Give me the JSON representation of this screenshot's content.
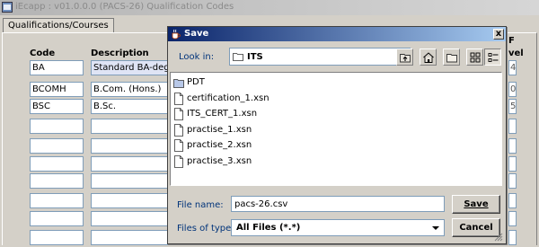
{
  "app": {
    "title": "iEcapp : v01.0.0.0 (PACS-26) Qualification Codes",
    "tab": "Qualifications/Courses"
  },
  "grid": {
    "headers": {
      "code": "Code",
      "description": "Description",
      "right_top": "F",
      "right_bottom": "vel"
    },
    "rows": [
      {
        "code": "BA",
        "description": "Standard BA-degree",
        "right": "4"
      },
      {
        "code": "BCOMH",
        "description": "B.Com. (Hons.)",
        "right": "0"
      },
      {
        "code": "BSC",
        "description": "B.Sc.",
        "right": "5"
      },
      {
        "code": "",
        "description": "",
        "right": ""
      },
      {
        "code": "",
        "description": "",
        "right": ""
      },
      {
        "code": "",
        "description": "",
        "right": ""
      },
      {
        "code": "",
        "description": "",
        "right": ""
      },
      {
        "code": "",
        "description": "",
        "right": ""
      },
      {
        "code": "",
        "description": "",
        "right": ""
      },
      {
        "code": "",
        "description": "",
        "right": ""
      }
    ]
  },
  "dialog": {
    "title": "Save",
    "close_label": "x",
    "look_in_label": "Look in:",
    "look_in_value": "ITS",
    "toolbar_icons": [
      "up-one-level-icon",
      "home-icon",
      "new-folder-icon",
      "list-view-icon",
      "details-view-icon"
    ],
    "files": [
      {
        "name": "PDT",
        "type": "folder"
      },
      {
        "name": "certification_1.xsn",
        "type": "file"
      },
      {
        "name": "ITS_CERT_1.xsn",
        "type": "file"
      },
      {
        "name": "practise_1.xsn",
        "type": "file"
      },
      {
        "name": "practise_2.xsn",
        "type": "file"
      },
      {
        "name": "practise_3.xsn",
        "type": "file"
      }
    ],
    "file_name_label": "File name:",
    "file_name_value": "pacs-26.csv",
    "files_of_type_label": "Files of type:",
    "files_of_type_value": "All Files (*.*)",
    "save_button": "Save",
    "cancel_button": "Cancel"
  },
  "colors": {
    "dialog_title_start": "#0a246a",
    "dialog_title_end": "#a6caf0",
    "label_blue": "#00337a",
    "field_border": "#7f9db9",
    "window_bg": "#d4d0c8"
  }
}
